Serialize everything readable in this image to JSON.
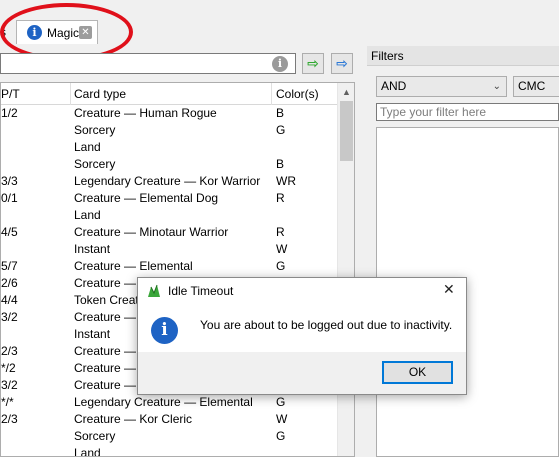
{
  "tabs": {
    "left_partial_label": "s",
    "magic_label": "Magic",
    "close_glyph": "✕",
    "info_glyph": "i"
  },
  "annotation": {
    "highlight_color": "#e0101a"
  },
  "search": {
    "value": "",
    "info_glyph": "i",
    "green_arrow": "⇨",
    "blue_arrow": "⇨"
  },
  "table": {
    "headers": {
      "pt": "P/T",
      "card_type": "Card type",
      "colors": "Color(s)"
    },
    "rows": [
      {
        "pt": "1/2",
        "type": "Creature — Human Rogue",
        "colors": "B"
      },
      {
        "pt": "",
        "type": "Sorcery",
        "colors": "G"
      },
      {
        "pt": "",
        "type": "Land",
        "colors": ""
      },
      {
        "pt": "",
        "type": "Sorcery",
        "colors": "B"
      },
      {
        "pt": "3/3",
        "type": "Legendary Creature — Kor Warrior",
        "colors": "WR"
      },
      {
        "pt": "0/1",
        "type": "Creature — Elemental Dog",
        "colors": "R"
      },
      {
        "pt": "",
        "type": "Land",
        "colors": ""
      },
      {
        "pt": "4/5",
        "type": "Creature — Minotaur Warrior",
        "colors": "R"
      },
      {
        "pt": "",
        "type": "Instant",
        "colors": "W"
      },
      {
        "pt": "5/7",
        "type": "Creature — Elemental",
        "colors": "G"
      },
      {
        "pt": "2/6",
        "type": "Creature — ",
        "colors": ""
      },
      {
        "pt": "4/4",
        "type": "Token Creatu",
        "colors": ""
      },
      {
        "pt": "3/2",
        "type": "Creature — ",
        "colors": ""
      },
      {
        "pt": "",
        "type": "Instant",
        "colors": ""
      },
      {
        "pt": "2/3",
        "type": "Creature — ",
        "colors": ""
      },
      {
        "pt": "*/2",
        "type": "Creature — ",
        "colors": ""
      },
      {
        "pt": "3/2",
        "type": "Creature — ",
        "colors": ""
      },
      {
        "pt": "*/*",
        "type": "Legendary Creature — Elemental",
        "colors": "G"
      },
      {
        "pt": "2/3",
        "type": "Creature — Kor Cleric",
        "colors": "W"
      },
      {
        "pt": "",
        "type": "Sorcery",
        "colors": "G"
      },
      {
        "pt": "",
        "type": "Land",
        "colors": ""
      }
    ]
  },
  "filters": {
    "header": "Filters",
    "logic_select": "AND",
    "field_select": "CMC",
    "input_placeholder": "Type your filter here"
  },
  "dialog": {
    "title": "Idle Timeout",
    "message": "You are about to be logged out due to inactivity.",
    "ok_label": "OK",
    "close_glyph": "✕",
    "info_glyph": "i"
  }
}
